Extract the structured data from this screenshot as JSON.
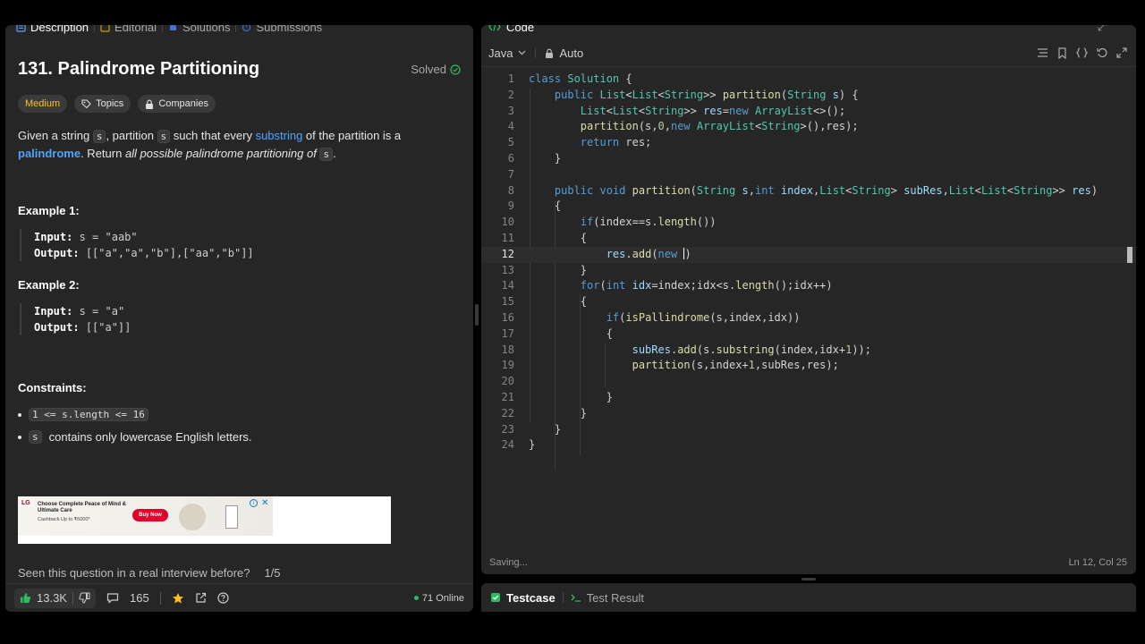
{
  "left_tabs": [
    {
      "label": "Description",
      "icon": "description-icon"
    },
    {
      "label": "Editorial",
      "icon": "editorial-icon"
    },
    {
      "label": "Solutions",
      "icon": "solutions-icon"
    },
    {
      "label": "Submissions",
      "icon": "submissions-icon"
    }
  ],
  "problem": {
    "title": "131. Palindrome Partitioning",
    "status": "Solved",
    "difficulty": "Medium",
    "topics_label": "Topics",
    "companies_label": "Companies",
    "desc": {
      "p1": "Given a string ",
      "s": "s",
      "p2": ", partition ",
      "p3": " such that every ",
      "substring": "substring",
      "p4": " of the partition is a",
      "palindrome": "palindrome",
      "p5": ". Return ",
      "italic": "all possible palindrome partitioning of",
      "p6": "."
    },
    "example1_title": "Example 1:",
    "example1_input_label": "Input:",
    "example1_input": "s = \"aab\"",
    "example1_output_label": "Output:",
    "example1_output": "[[\"a\",\"a\",\"b\"],[\"aa\",\"b\"]]",
    "example2_title": "Example 2:",
    "example2_input_label": "Input:",
    "example2_input": "s = \"a\"",
    "example2_output_label": "Output:",
    "example2_output": "[[\"a\"]]",
    "constraints_title": "Constraints:",
    "constraint1": "1 <= s.length <= 16",
    "constraint2_code": "s",
    "constraint2_text": "contains only lowercase English letters."
  },
  "ad": {
    "brand": "LG",
    "headline": "Choose Complete Peace of Mind & Ultimate Care",
    "sub": "Cashback Up to ₹6000*",
    "cta": "Buy Now",
    "tc": "*T&C Apply"
  },
  "interview": {
    "question": "Seen this question in a real interview before?",
    "pager": "1/5"
  },
  "footer": {
    "likes": "13.3K",
    "comments": "165",
    "online": "71 Online"
  },
  "code_panel": {
    "title": "Code",
    "language": "Java",
    "mode": "Auto",
    "status_left": "Saving...",
    "status_right": "Ln 12, Col 25",
    "active_line": 12
  },
  "bottom_tabs": {
    "testcase": "Testcase",
    "test_result": "Test Result"
  },
  "code_lines": [
    "1",
    "2",
    "3",
    "4",
    "5",
    "6",
    "7",
    "8",
    "9",
    "10",
    "11",
    "12",
    "13",
    "14",
    "15",
    "16",
    "17",
    "18",
    "19",
    "20",
    "21",
    "22",
    "23",
    "24"
  ],
  "colors": {
    "accent_green": "#2cbb5d",
    "medium": "#ffc01e",
    "link": "#4ea5ff"
  }
}
